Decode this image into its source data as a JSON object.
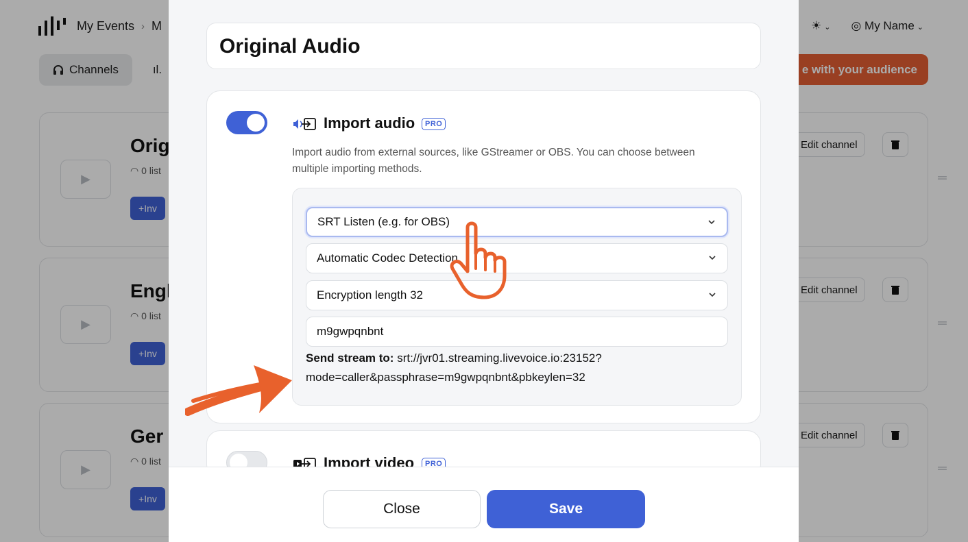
{
  "app": {
    "breadcrumb": [
      "My Events",
      "M"
    ],
    "breadcrumb_separator": "›",
    "theme_label": "☀",
    "user_name": "My Name",
    "tabs": [
      {
        "label": "Channels",
        "active": true
      },
      {
        "label": "ıl.",
        "active": false
      }
    ],
    "share_button": "e with your audience",
    "channels": [
      {
        "title": "Orig",
        "listeners": "0 list",
        "invite": "Inv",
        "edit": "Edit channel"
      },
      {
        "title": "Engl",
        "listeners": "0 list",
        "invite": "Inv",
        "edit": "Edit channel"
      },
      {
        "title": "Ger",
        "listeners": "0 list",
        "invite": "Inv",
        "edit": "Edit channel"
      }
    ]
  },
  "modal": {
    "title": "Original Audio",
    "import_audio": {
      "enabled": true,
      "title": "Import audio",
      "badge": "PRO",
      "description": "Import audio from external sources, like GStreamer or OBS. You can choose between multiple importing methods.",
      "method": "SRT Listen (e.g. for OBS)",
      "codec": "Automatic Codec Detection",
      "encryption": "Encryption length 32",
      "passphrase": "m9gwpqnbnt",
      "stream_label": "Send stream to:",
      "stream_url": "srt://jvr01.streaming.livevoice.io:23152?mode=caller&passphrase=m9gwpqnbnt&pbkeylen=32"
    },
    "import_video": {
      "enabled": false,
      "title": "Import video",
      "badge": "PRO"
    },
    "close_label": "Close",
    "save_label": "Save"
  },
  "colors": {
    "accent": "#3f61d6",
    "share_orange": "#e55f33",
    "annotation_orange": "#e8612c"
  }
}
